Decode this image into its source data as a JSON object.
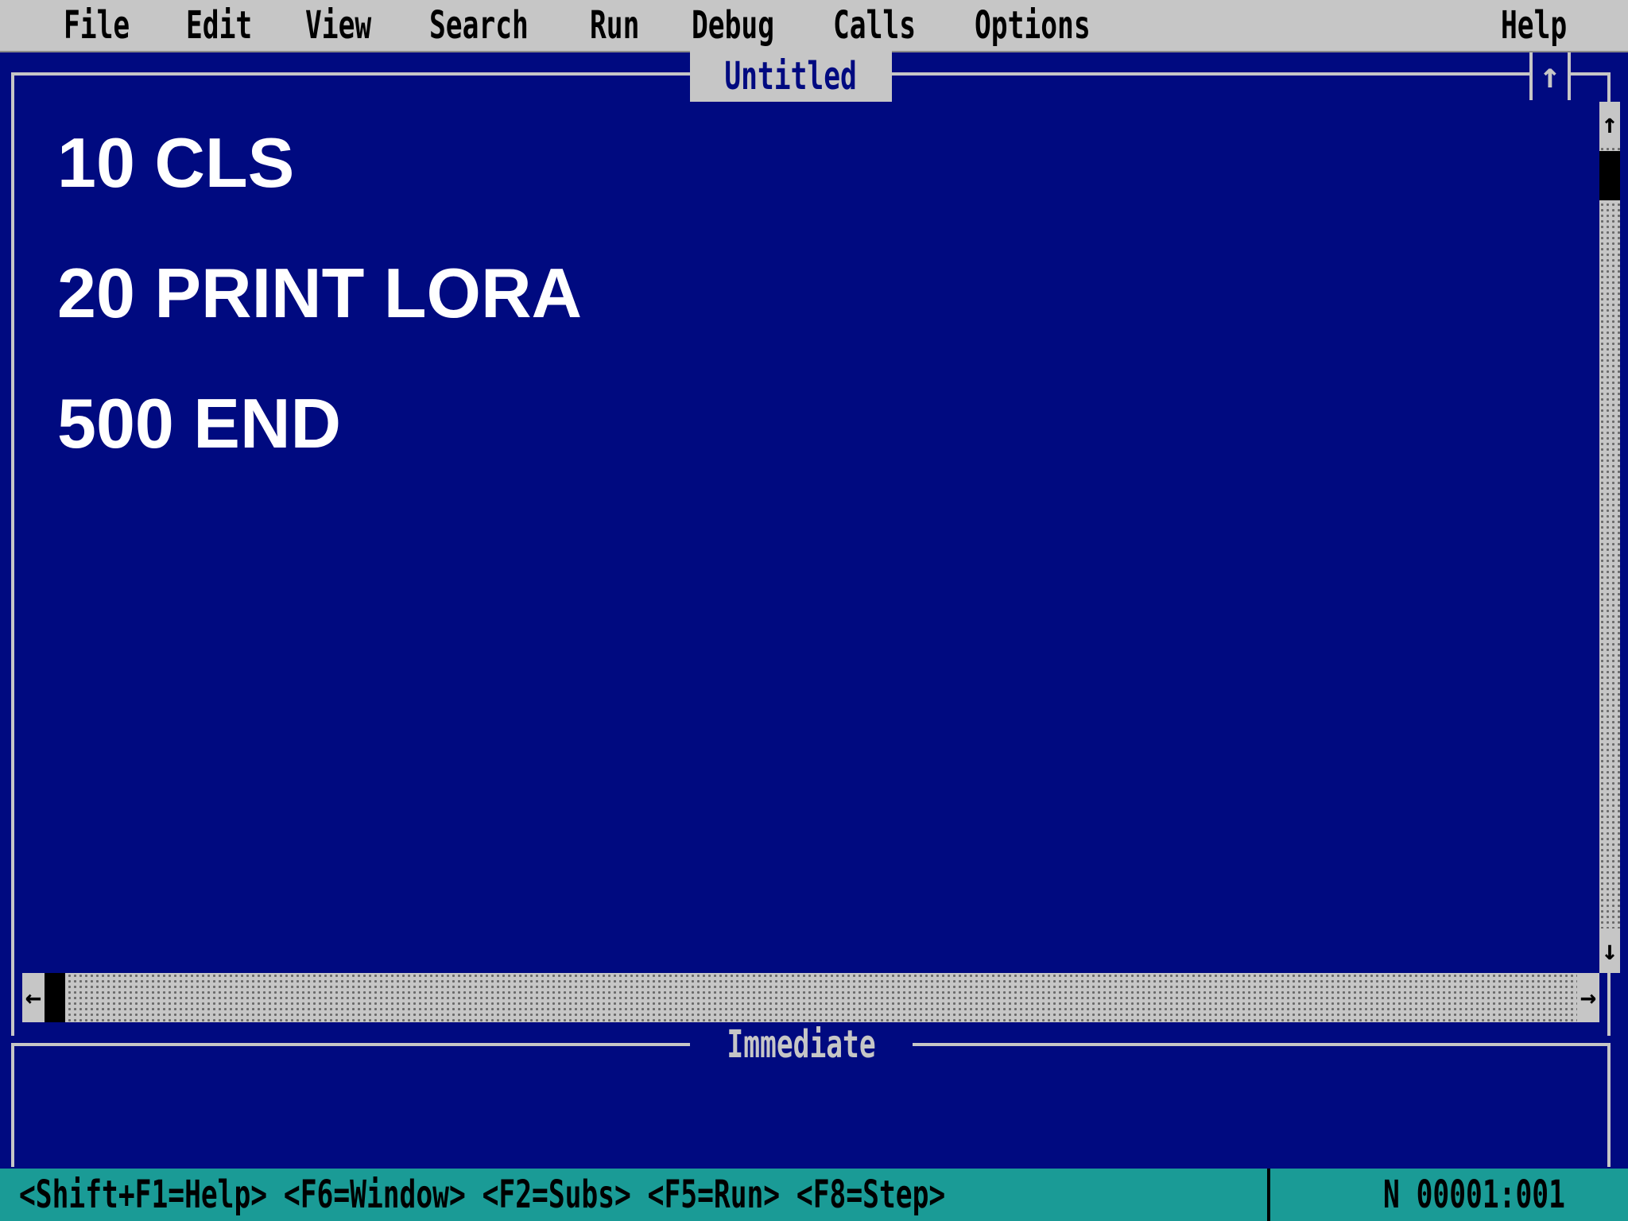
{
  "menubar": {
    "items": [
      {
        "label": "File"
      },
      {
        "label": "Edit"
      },
      {
        "label": "View"
      },
      {
        "label": "Search"
      },
      {
        "label": "Run"
      },
      {
        "label": "Debug"
      },
      {
        "label": "Calls"
      },
      {
        "label": "Options"
      },
      {
        "label": "Help"
      }
    ]
  },
  "editor": {
    "title": "Untitled",
    "maximize_glyph": "↑",
    "lines": [
      {
        "text": "10 CLS"
      },
      {
        "text": "20 PRINT LORA"
      },
      {
        "text": "500 END"
      }
    ],
    "vscroll": {
      "up": "↑",
      "down": "↓"
    },
    "hscroll": {
      "left": "←",
      "right": "→"
    }
  },
  "immediate": {
    "title": "Immediate"
  },
  "statusbar": {
    "hints": "<Shift+F1=Help> <F6=Window> <F2=Subs> <F5=Run> <F8=Step>",
    "position": "N 00001:001"
  },
  "colors": {
    "background": "#000a80",
    "menubar": "#c6c6c6",
    "statusbar": "#1a9b96",
    "text": "#ffffff"
  }
}
